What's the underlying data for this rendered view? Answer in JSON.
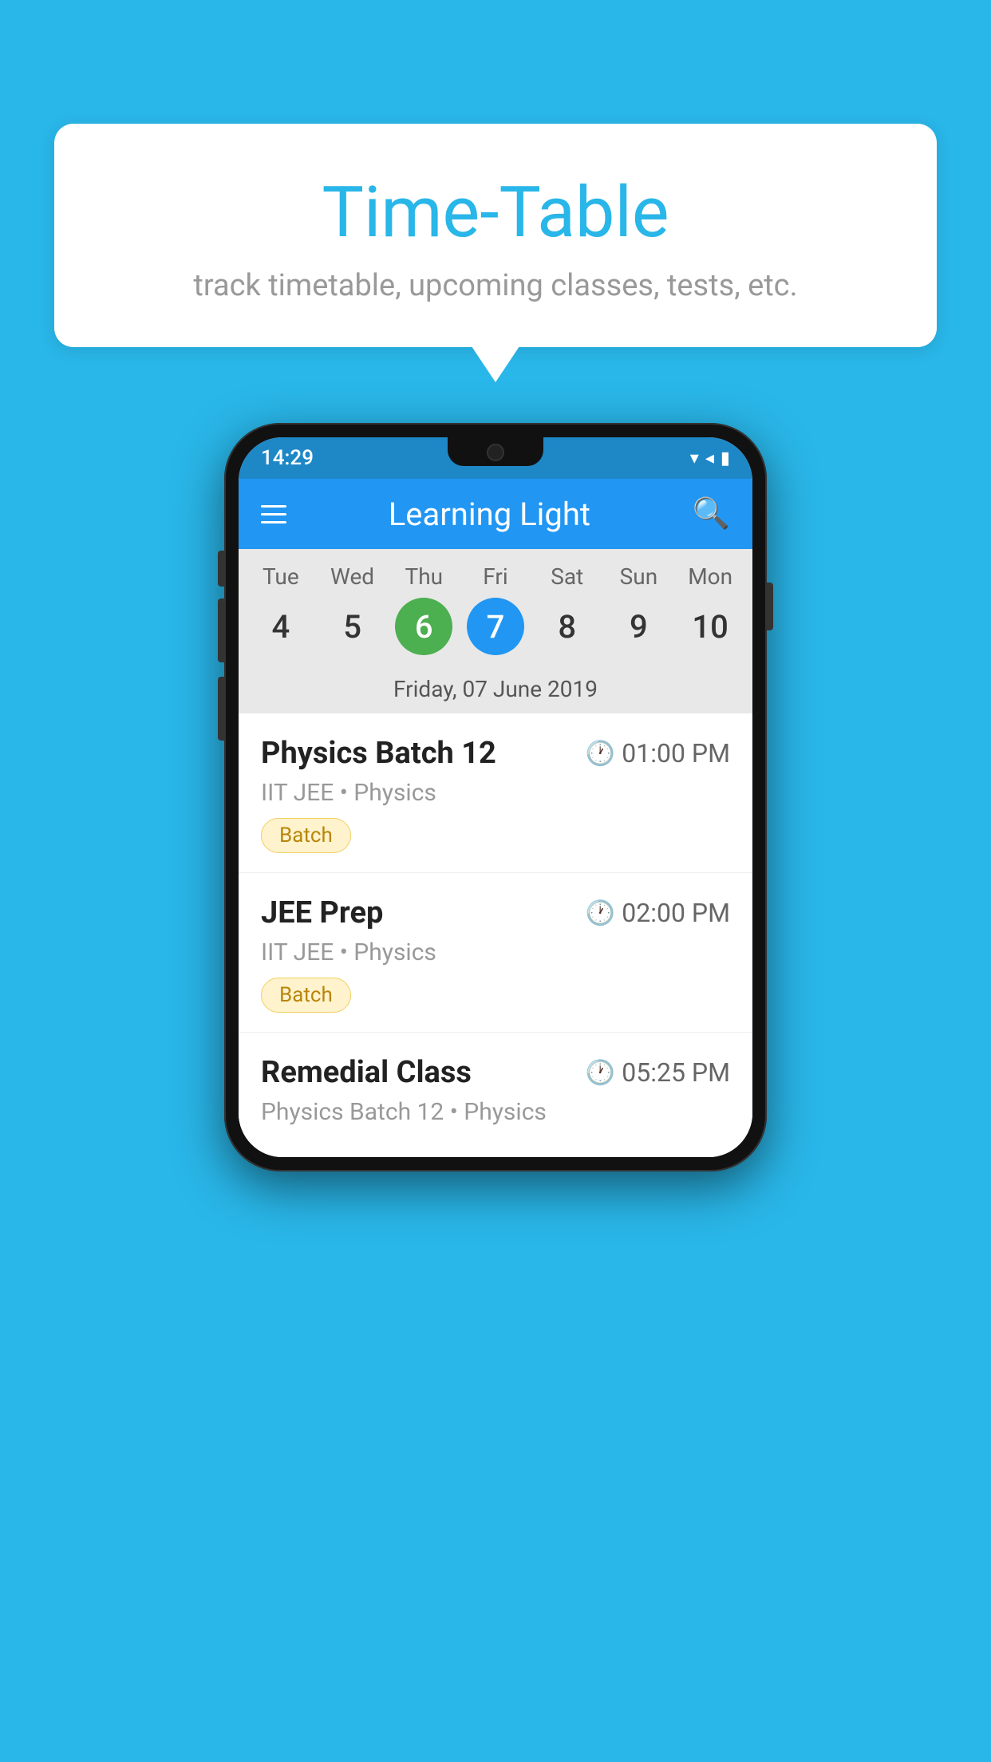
{
  "background": {
    "color": "#29b6e8"
  },
  "bubble": {
    "title": "Time-Table",
    "subtitle": "track timetable, upcoming classes, tests, etc."
  },
  "phone": {
    "statusBar": {
      "time": "14:29"
    },
    "appBar": {
      "title": "Learning Light"
    },
    "calendar": {
      "days": [
        "Tue",
        "Wed",
        "Thu",
        "Fri",
        "Sat",
        "Sun",
        "Mon"
      ],
      "dates": [
        "4",
        "5",
        "6",
        "7",
        "8",
        "9",
        "10"
      ],
      "todayIndex": 2,
      "selectedIndex": 3,
      "selectedDateLabel": "Friday, 07 June 2019"
    },
    "schedule": [
      {
        "title": "Physics Batch 12",
        "time": "01:00 PM",
        "meta": "IIT JEE • Physics",
        "tag": "Batch"
      },
      {
        "title": "JEE Prep",
        "time": "02:00 PM",
        "meta": "IIT JEE • Physics",
        "tag": "Batch"
      },
      {
        "title": "Remedial Class",
        "time": "05:25 PM",
        "meta": "Physics Batch 12 • Physics",
        "tag": ""
      }
    ]
  }
}
